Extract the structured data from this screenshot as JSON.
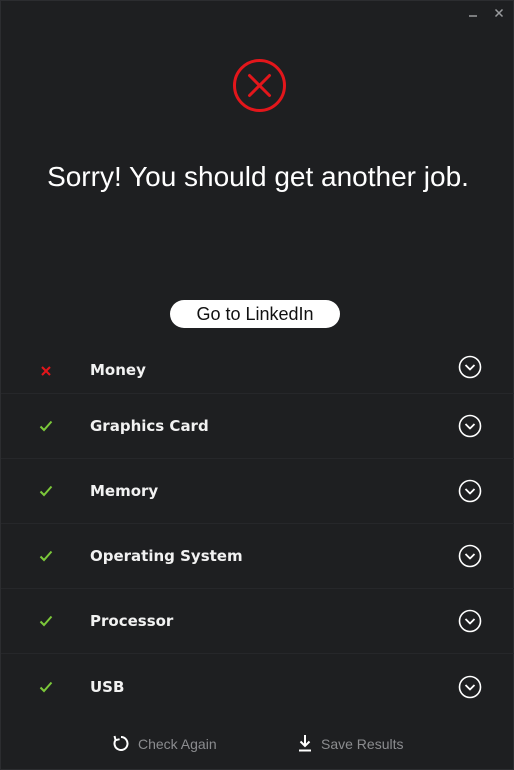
{
  "window": {
    "controls": {
      "minimize_icon": "minimize-icon",
      "close_icon": "close-icon"
    }
  },
  "hero": {
    "icon": "error-x-circle-icon",
    "color": "#e3161b"
  },
  "headline": "Sorry! You should get another job.",
  "linkedin_button": "Go to LinkedIn",
  "requirements": [
    {
      "label": "Money",
      "status": "fail"
    },
    {
      "label": "Graphics Card",
      "status": "pass"
    },
    {
      "label": "Memory",
      "status": "pass"
    },
    {
      "label": "Operating System",
      "status": "pass"
    },
    {
      "label": "Processor",
      "status": "pass"
    },
    {
      "label": "USB",
      "status": "pass"
    }
  ],
  "status_symbols": {
    "fail": "x",
    "pass": "✓"
  },
  "colors": {
    "pass": "#7cc83a",
    "fail": "#e3161b",
    "background": "#1e1f21"
  },
  "footer": {
    "check_again": "Check Again",
    "save_results": "Save Results"
  }
}
